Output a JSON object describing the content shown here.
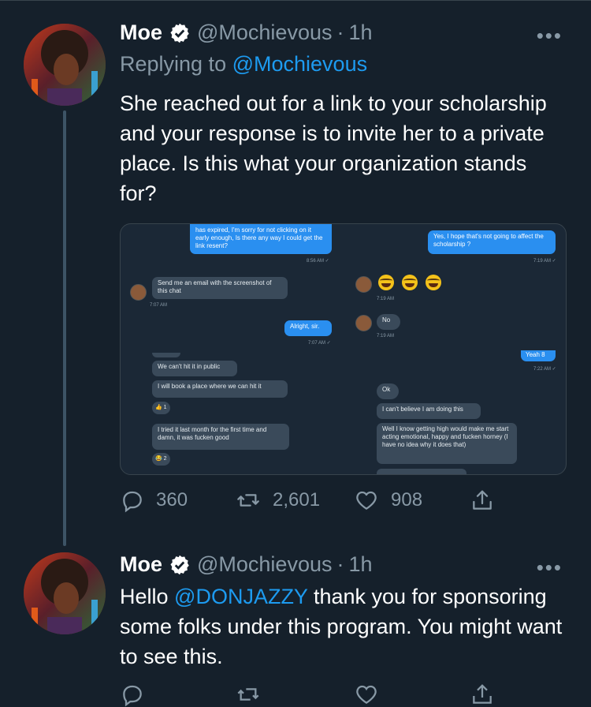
{
  "tweet1": {
    "name": "Moe",
    "handle": "@Mochievous",
    "separator": "·",
    "time": "1h",
    "more": "•••",
    "replying_prefix": "Replying to",
    "replying_handle": "@Mochievous",
    "text": "She reached out for a link to your scholarship and your response is to invite her to a private place. Is this what your organization stands for?",
    "stats": {
      "replies": "360",
      "retweets": "2,601",
      "likes": "908"
    }
  },
  "screenshot": {
    "left": {
      "msg1": "has expired, I'm sorry for not clicking on it early enough, Is there any way I could get the link resent?",
      "ts1": "8:56 AM ✓",
      "msg2": "Send me an email with the screenshot of this chat",
      "ts2": "7:07 AM",
      "msg3": "Alright, sir.",
      "ts3": "7:07 AM ✓",
      "msg4": "We can't hit it in public",
      "msg5": "I will book a place where we can hit it",
      "react1": "1",
      "msg6": "I tried it last month for the first time and damn, it was fucken good",
      "react2": "2"
    },
    "right": {
      "msg1": "Yes, I hope that's not going to affect the scholarship ?",
      "ts1": "7:19 AM ✓",
      "ts2": "7:19 AM",
      "msg2": "No",
      "ts3": "7:19 AM",
      "msg3": "Yeah 8",
      "ts4": "7:22 AM ✓",
      "msg4": "Ok",
      "msg5": "I can't believe I am doing this",
      "msg6": "Well I know getting high would make me start acting emotional, happy and fucken horney (I have no idea why it does that)"
    }
  },
  "tweet2": {
    "name": "Moe",
    "handle": "@Mochievous",
    "separator": "·",
    "time": "1h",
    "more": "•••",
    "text_pre": "Hello ",
    "mention": "@DONJAZZY",
    "text_post": " thank you for sponsoring some folks under this program. You might want to see this."
  },
  "colors": {
    "background": "#15202b",
    "link": "#1d9bf0",
    "muted": "#8899a6",
    "verified": "#ffffff"
  }
}
